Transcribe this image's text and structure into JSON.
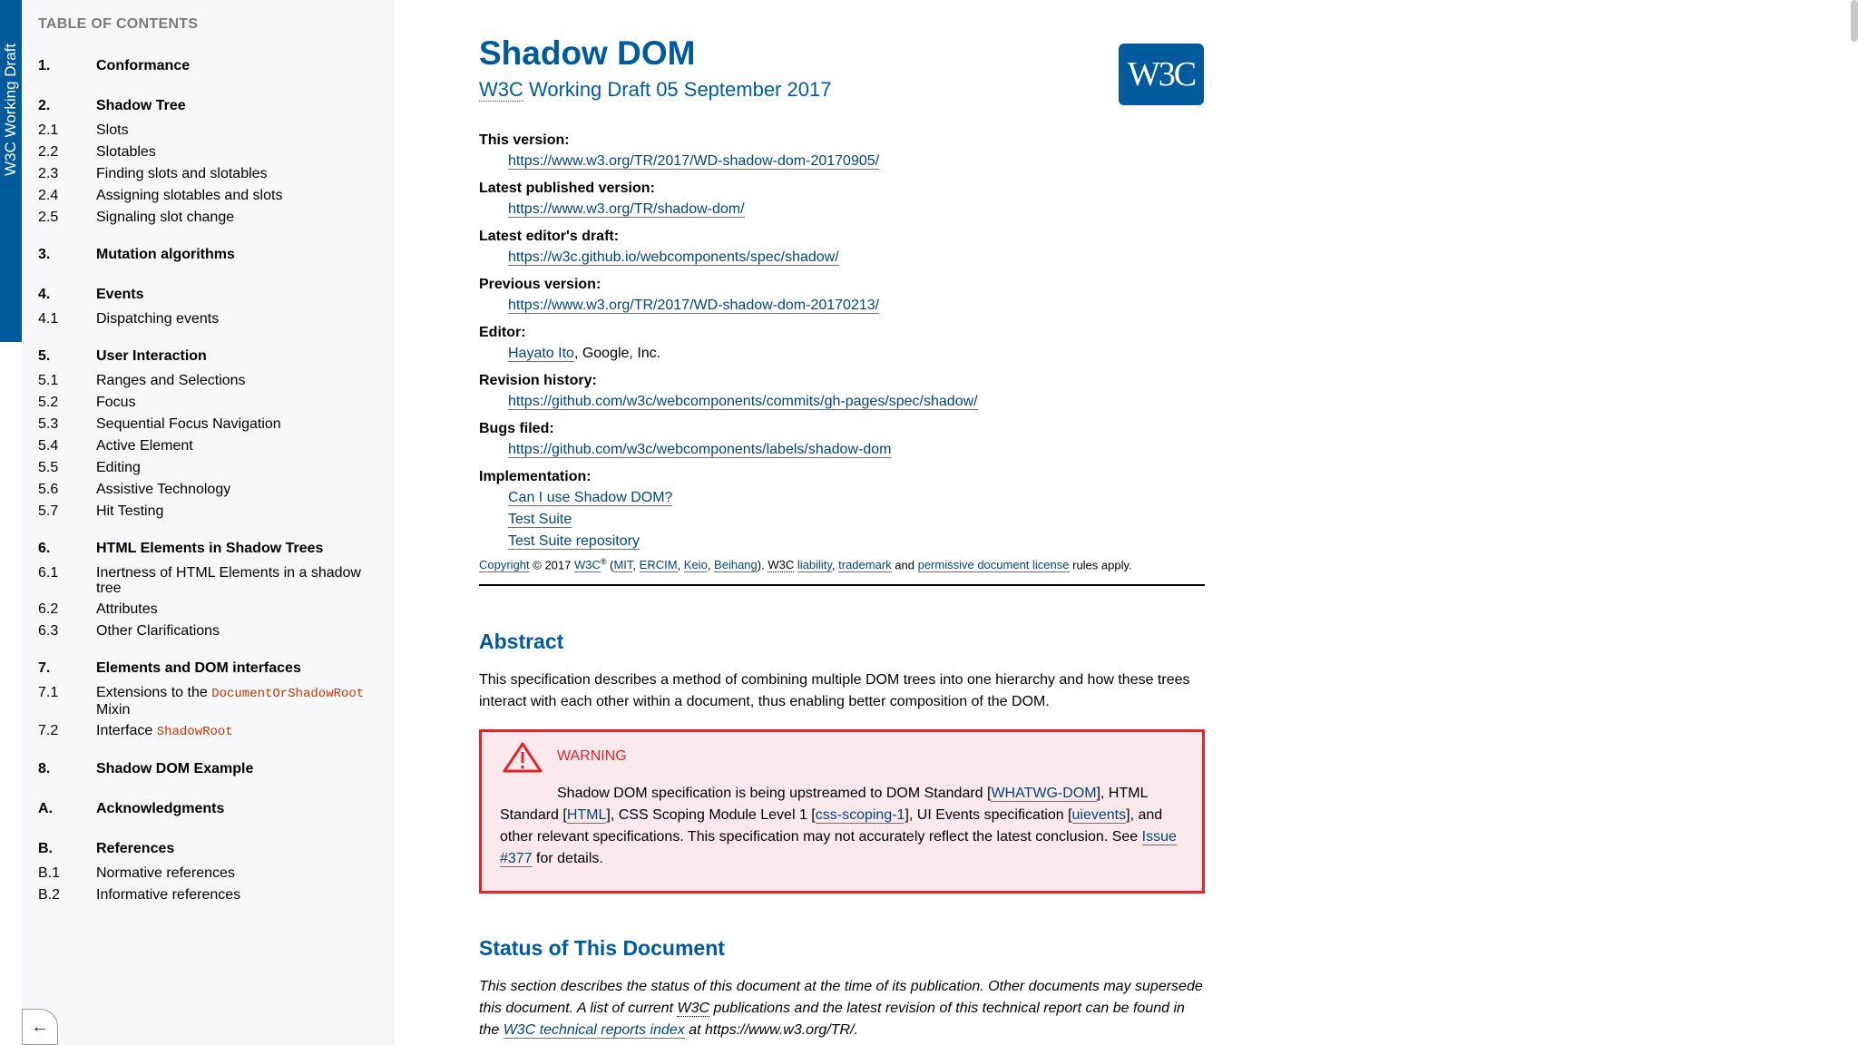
{
  "ribbon": {
    "label": "W3C Working Draft"
  },
  "toc": {
    "heading": "TABLE OF CONTENTS",
    "groups": [
      {
        "num": "1.",
        "title": "Conformance",
        "items": []
      },
      {
        "num": "2.",
        "title": "Shadow Tree",
        "items": [
          {
            "num": "2.1",
            "title": "Slots"
          },
          {
            "num": "2.2",
            "title": "Slotables"
          },
          {
            "num": "2.3",
            "title": "Finding slots and slotables"
          },
          {
            "num": "2.4",
            "title": "Assigning slotables and slots"
          },
          {
            "num": "2.5",
            "title": "Signaling slot change"
          }
        ]
      },
      {
        "num": "3.",
        "title": "Mutation algorithms",
        "items": []
      },
      {
        "num": "4.",
        "title": "Events",
        "items": [
          {
            "num": "4.1",
            "title": "Dispatching events"
          }
        ]
      },
      {
        "num": "5.",
        "title": "User Interaction",
        "items": [
          {
            "num": "5.1",
            "title": "Ranges and Selections"
          },
          {
            "num": "5.2",
            "title": "Focus"
          },
          {
            "num": "5.3",
            "title": "Sequential Focus Navigation"
          },
          {
            "num": "5.4",
            "title": "Active Element"
          },
          {
            "num": "5.5",
            "title": "Editing"
          },
          {
            "num": "5.6",
            "title": "Assistive Technology"
          },
          {
            "num": "5.7",
            "title": "Hit Testing"
          }
        ]
      },
      {
        "num": "6.",
        "title": "HTML Elements in Shadow Trees",
        "items": [
          {
            "num": "6.1",
            "title": "Inertness of HTML Elements in a shadow tree"
          },
          {
            "num": "6.2",
            "title": "Attributes"
          },
          {
            "num": "6.3",
            "title": "Other Clarifications"
          }
        ]
      },
      {
        "num": "7.",
        "title": "Elements and DOM interfaces",
        "items": [
          {
            "num": "7.1",
            "title": "Extensions to the ",
            "code": "DocumentOrShadowRoot",
            "suffix": " Mixin"
          },
          {
            "num": "7.2",
            "title": "Interface ",
            "code": "ShadowRoot",
            "suffix": ""
          }
        ]
      },
      {
        "num": "8.",
        "title": "Shadow DOM Example",
        "items": []
      },
      {
        "num": "A.",
        "title": "Acknowledgments",
        "items": []
      },
      {
        "num": "B.",
        "title": "References",
        "items": [
          {
            "num": "B.1",
            "title": "Normative references"
          },
          {
            "num": "B.2",
            "title": "Informative references"
          }
        ]
      }
    ]
  },
  "header": {
    "title": "Shadow DOM",
    "subtitle_abbr": "W3C",
    "subtitle_rest": " Working Draft 05 September 2017",
    "logo": "W3C"
  },
  "meta": [
    {
      "label": "This version:",
      "values": [
        "https://www.w3.org/TR/2017/WD-shadow-dom-20170905/"
      ]
    },
    {
      "label": "Latest published version:",
      "values": [
        "https://www.w3.org/TR/shadow-dom/"
      ]
    },
    {
      "label": "Latest editor's draft:",
      "values": [
        "https://w3c.github.io/webcomponents/spec/shadow/"
      ]
    },
    {
      "label": "Previous version:",
      "values": [
        "https://www.w3.org/TR/2017/WD-shadow-dom-20170213/"
      ]
    },
    {
      "label": "Editor:",
      "values": [
        "Hayato Ito"
      ],
      "after": ", Google, Inc."
    },
    {
      "label": "Revision history:",
      "values": [
        "https://github.com/w3c/webcomponents/commits/gh-pages/spec/shadow/"
      ]
    },
    {
      "label": "Bugs filed:",
      "values": [
        "https://github.com/w3c/webcomponents/labels/shadow-dom"
      ]
    },
    {
      "label": "Implementation:",
      "values": [
        "Can I use Shadow DOM?",
        "Test Suite",
        "Test Suite repository"
      ]
    }
  ],
  "copyright": {
    "copyright_link": "Copyright",
    "year": " © 2017 ",
    "w3c": "W3C",
    "reg": "®",
    "open": " (",
    "mit": "MIT",
    "ercim": "ERCIM",
    "keio": "Keio",
    "beihang": "Beihang",
    "close": "). ",
    "w3c2": "W3C",
    "liability": "liability",
    "trademark": "trademark",
    "and": " and ",
    "license": "permissive document license",
    "tail": " rules apply."
  },
  "abstract": {
    "heading": "Abstract",
    "text": "This specification describes a method of combining multiple DOM trees into one hierarchy and how these trees interact with each other within a document, thus enabling better composition of the DOM."
  },
  "warning": {
    "label": "WARNING",
    "t1": "Shadow DOM specification is being upstreamed to DOM Standard [",
    "l1": "WHATWG-DOM",
    "t2": "], HTML Standard [",
    "l2": "HTML",
    "t3": "], CSS Scoping Module Level 1 [",
    "l3": "css-scoping-1",
    "t4": "], UI Events specification [",
    "l4": "uievents",
    "t5": "], and other relevant specifications. This specification may not accurately reflect the latest conclusion. See ",
    "l5": "Issue #377",
    "t6": " for details."
  },
  "status": {
    "heading": "Status of This Document",
    "t1": "This section describes the status of this document at the time of its publication. Other documents may supersede this document. A list of current ",
    "abbr": "W3C",
    "t2": " publications and the latest revision of this technical report can be found in the ",
    "link": "W3C technical reports index",
    "t3": " at https://www.w3.org/TR/."
  },
  "colors": {
    "accent": "#005a9c",
    "warning": "#e0252b",
    "warning_bg": "#fbe9eb",
    "code": "#c63501"
  }
}
